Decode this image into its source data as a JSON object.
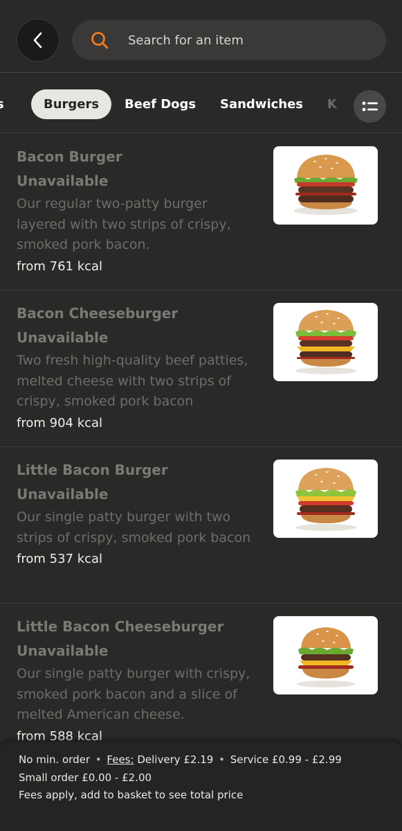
{
  "header": {
    "search_placeholder": "Search for an item"
  },
  "tabs": {
    "partial_left": "rs",
    "items": [
      "Burgers",
      "Beef Dogs",
      "Sandwiches"
    ],
    "partial_right": "K",
    "active": "Burgers"
  },
  "items": [
    {
      "name": "Bacon Burger",
      "status": "Unavailable",
      "description": "Our regular two-patty burger layered with two strips of crispy, smoked pork bacon.",
      "kcal": "from 761 kcal"
    },
    {
      "name": "Bacon Cheeseburger",
      "status": "Unavailable",
      "description": "Two fresh high-quality beef patties, melted cheese with two strips of crispy, smoked pork bacon",
      "kcal": "from 904 kcal"
    },
    {
      "name": "Little Bacon Burger",
      "status": "Unavailable",
      "description": "Our single patty burger with two strips of crispy, smoked pork bacon",
      "kcal": "from 537 kcal"
    },
    {
      "name": "Little Bacon Cheeseburger",
      "status": "Unavailable",
      "description": "Our single patty burger with crispy, smoked pork bacon and a slice of melted American cheese.",
      "kcal": "from 588 kcal"
    }
  ],
  "footer": {
    "min_order": "No min. order",
    "separator": "•",
    "fees_label": "Fees:",
    "delivery": "Delivery £2.19",
    "service": "Service £0.99 - £2.99",
    "small_order": "Small order £0.00 - £2.00",
    "note": "Fees apply, add to basket to see total price"
  },
  "icons": {
    "back": "chevron-left-icon",
    "search": "search-icon",
    "menu": "list-icon"
  },
  "colors": {
    "background": "#2a2928",
    "accent": "#f07a1e",
    "active_tab": "#e8e6e3"
  }
}
